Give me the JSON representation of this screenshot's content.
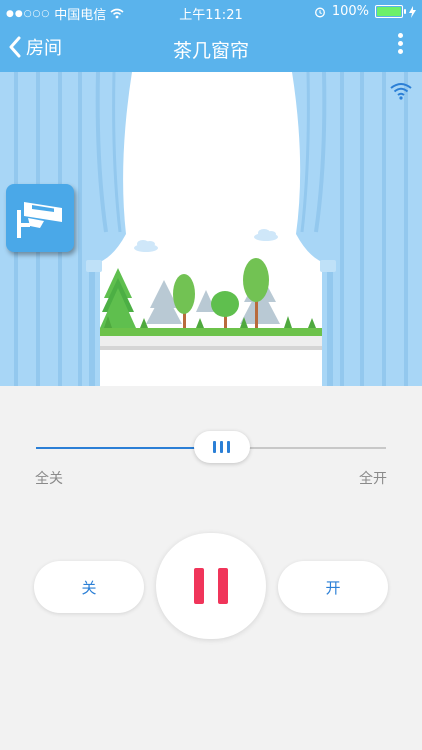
{
  "status_bar": {
    "carrier": "中国电信",
    "time": "上午11:21",
    "battery": "100%",
    "battery_level": 1.0
  },
  "nav": {
    "back_label": "房间",
    "title": "茶几窗帘"
  },
  "slider": {
    "value": 0.53,
    "min_label": "全关",
    "max_label": "全开"
  },
  "controls": {
    "close_label": "关",
    "open_label": "开"
  },
  "colors": {
    "accent": "#5ab3ec",
    "track_active": "#2b7fd6",
    "pause": "#f0355a",
    "curtain": "#a8d6f6"
  },
  "icons": {
    "camera": "security-camera-icon",
    "wifi": "wifi-icon",
    "back": "chevron-left-icon",
    "more": "more-vertical-icon",
    "pause": "pause-icon"
  }
}
